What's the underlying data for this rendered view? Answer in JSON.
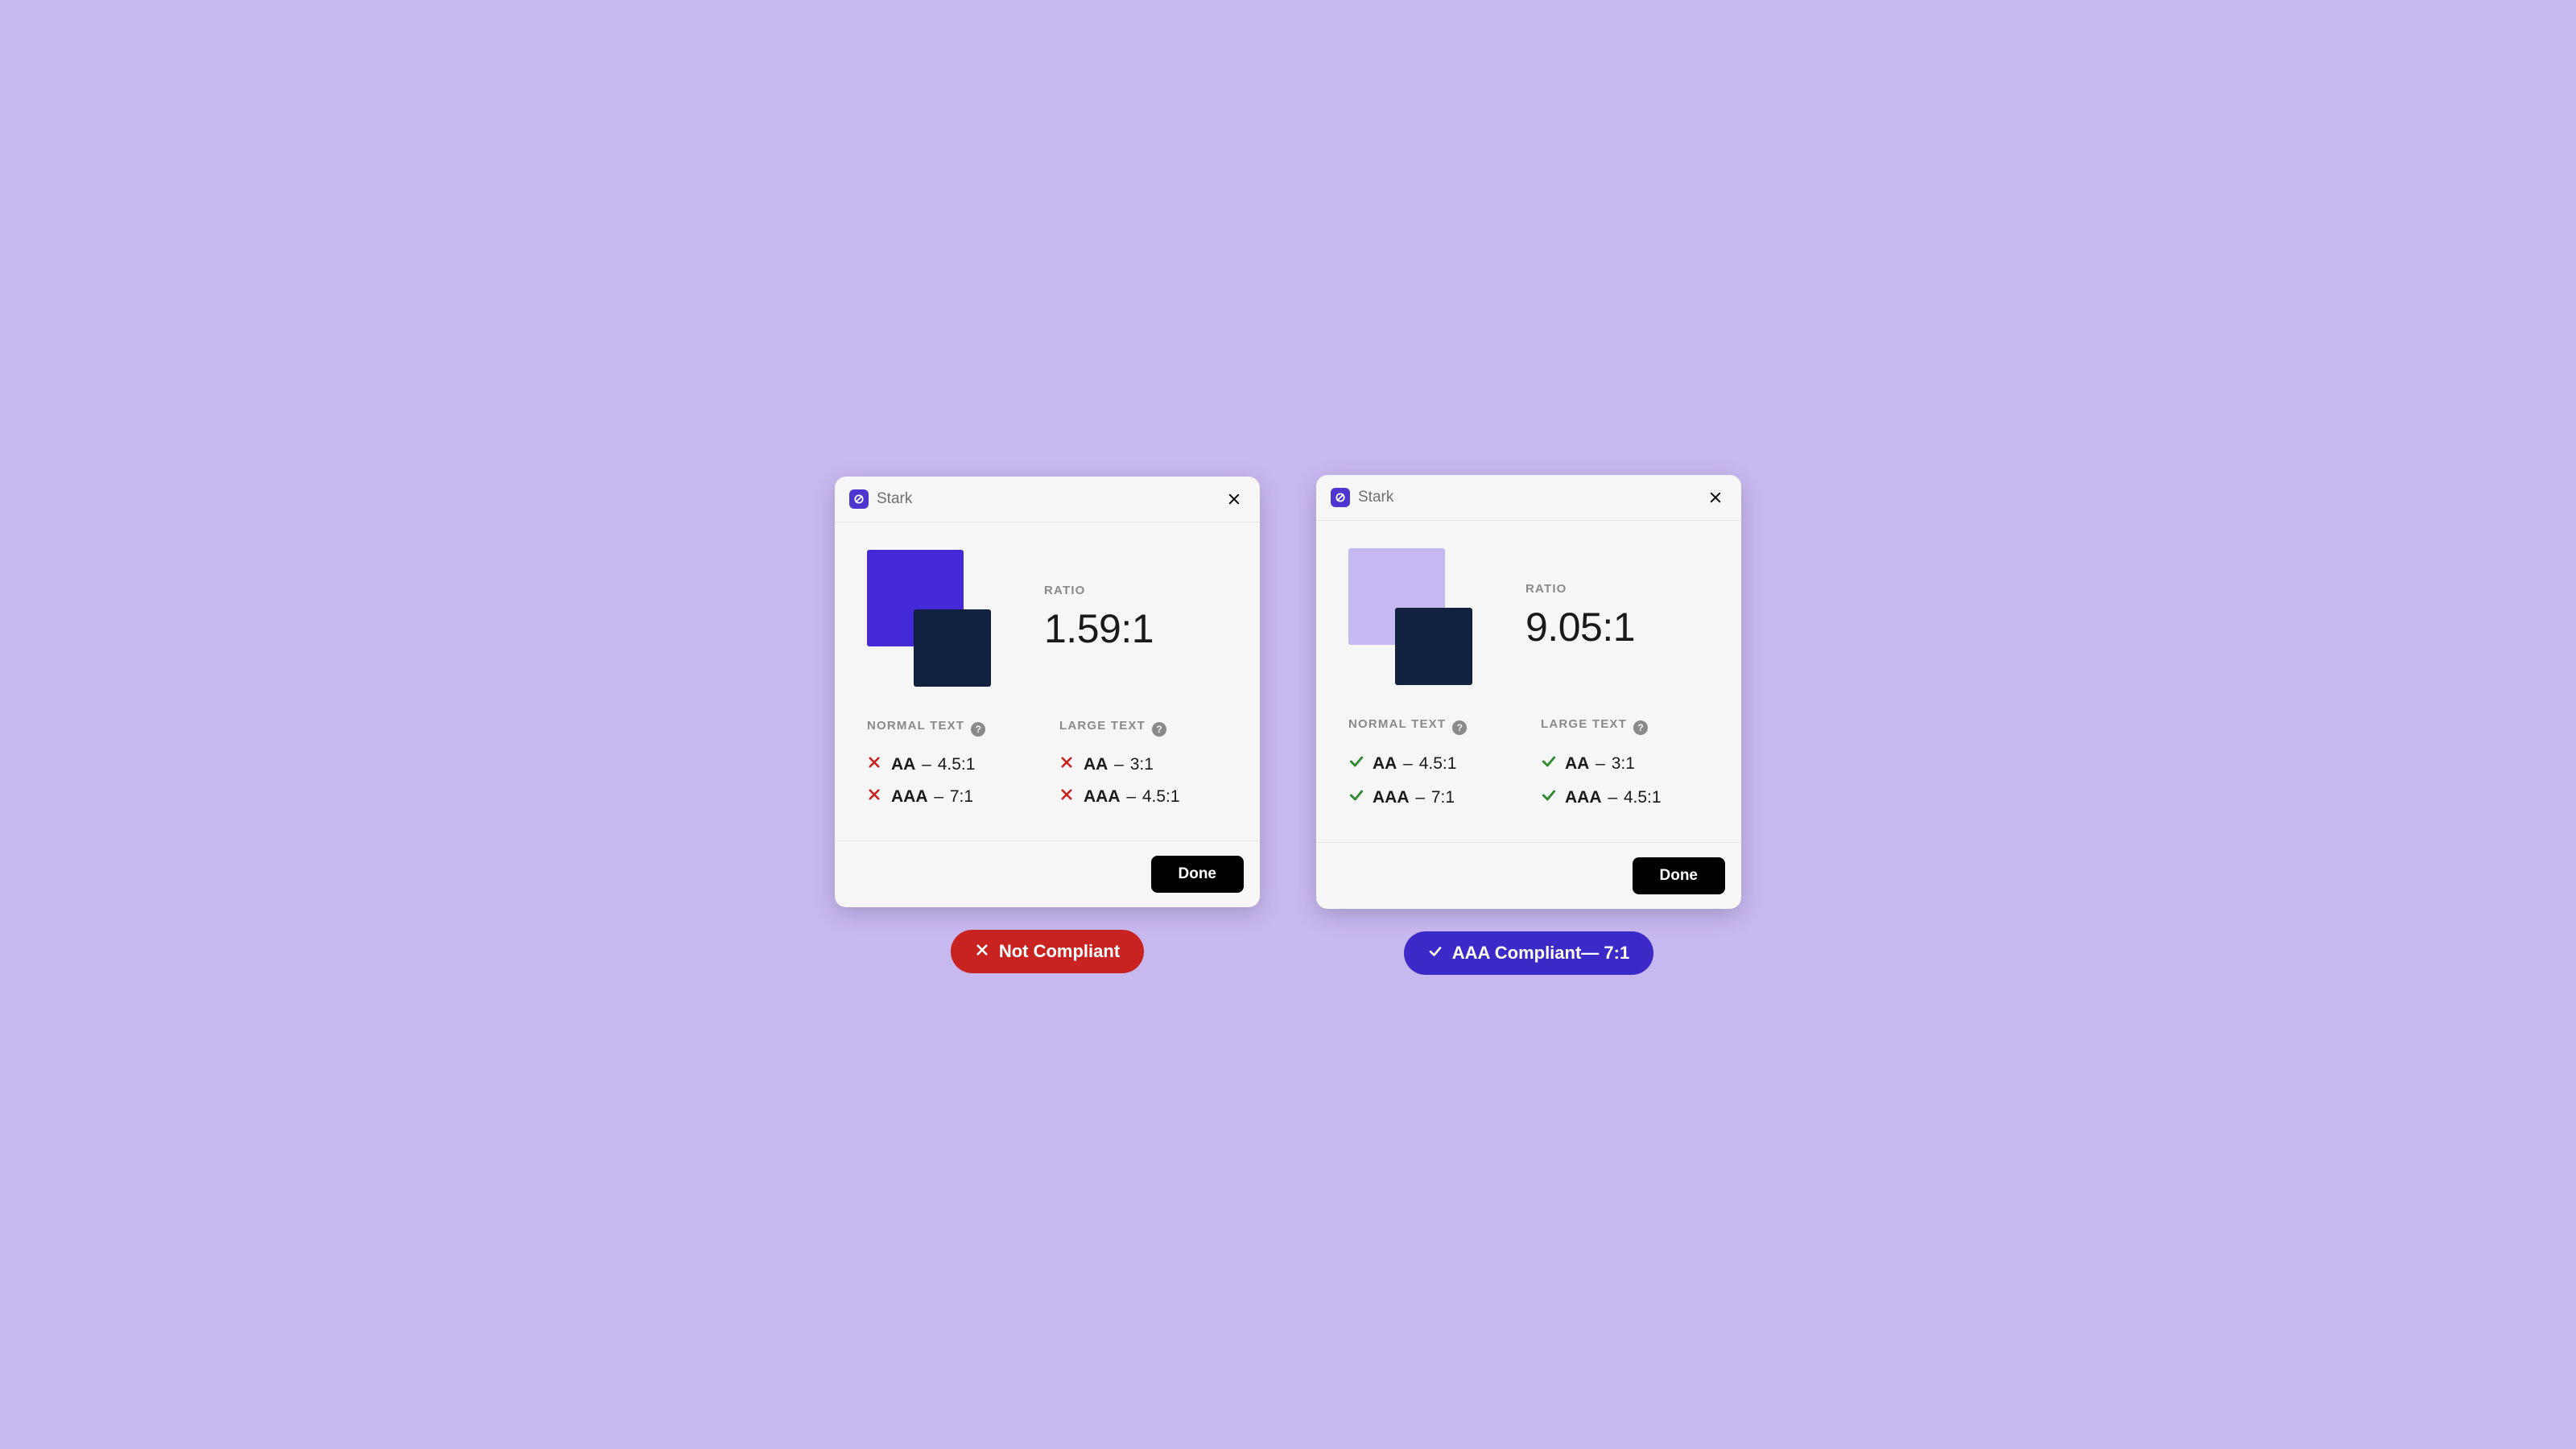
{
  "app": {
    "name": "Stark",
    "logo_bg": "#4d36cf"
  },
  "labels": {
    "ratio": "RATIO",
    "normal_text": "NORMAL TEXT",
    "large_text": "LARGE TEXT",
    "done": "Done"
  },
  "panels": [
    {
      "ratio": "1.59:1",
      "swatch_back": "#4429d6",
      "swatch_front": "#112341",
      "normal": [
        {
          "level": "AA",
          "threshold": "4.5:1",
          "pass": false
        },
        {
          "level": "AAA",
          "threshold": "7:1",
          "pass": false
        }
      ],
      "large": [
        {
          "level": "AA",
          "threshold": "3:1",
          "pass": false
        },
        {
          "level": "AAA",
          "threshold": "4.5:1",
          "pass": false
        }
      ],
      "badge": {
        "text": "Not Compliant",
        "bg": "#c82320",
        "icon": "x"
      }
    },
    {
      "ratio": "9.05:1",
      "swatch_back": "#c6b8f0",
      "swatch_front": "#112341",
      "normal": [
        {
          "level": "AA",
          "threshold": "4.5:1",
          "pass": true
        },
        {
          "level": "AAA",
          "threshold": "7:1",
          "pass": true
        }
      ],
      "large": [
        {
          "level": "AA",
          "threshold": "3:1",
          "pass": true
        },
        {
          "level": "AAA",
          "threshold": "4.5:1",
          "pass": true
        }
      ],
      "badge": {
        "text": "AAA Compliant— 7:1",
        "bg": "#3b2ac7",
        "icon": "check"
      }
    }
  ]
}
